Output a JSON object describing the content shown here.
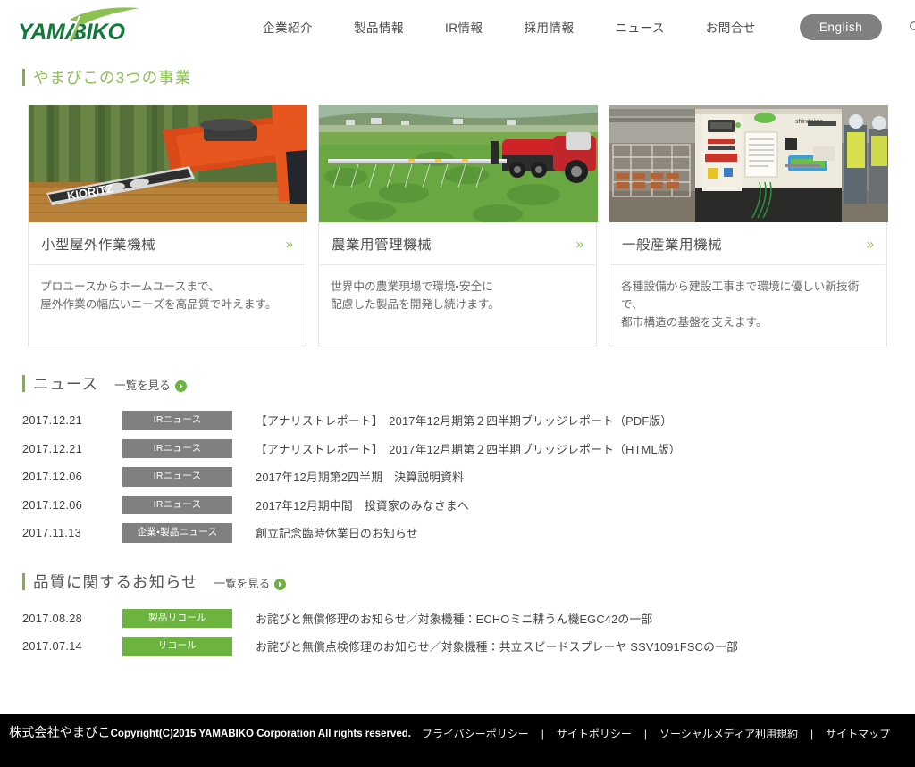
{
  "header": {
    "logo_text": "YAMABIKO",
    "logo_icon": "yamabiko-swoosh-logo",
    "nav": [
      {
        "label": "企業紹介"
      },
      {
        "label": "製品情報"
      },
      {
        "label": "IR情報"
      },
      {
        "label": "採用情報"
      },
      {
        "label": "ニュース"
      },
      {
        "label": "お問合せ"
      }
    ],
    "english_button": "English",
    "search_icon": "search-icon"
  },
  "business": {
    "heading": "やまびこの3つの事業",
    "cards": [
      {
        "title": "小型屋外作業機械",
        "desc": "プロユースからホームユースまで、\n屋外作業の幅広いニーズを高品質で叶えます。",
        "image_alt": "chainsaw-in-forest",
        "chevron": "»"
      },
      {
        "title": "農業用管理機械",
        "desc": "世界中の農業現場で環境・安全に\n配慮した製品を開発し続けます。",
        "image_alt": "agricultural-sprayer-in-field",
        "chevron": "»"
      },
      {
        "title": "一般産業用機械",
        "desc": "各種設備から建設工事まで環境に優しい新技術で、\n都市構造の基盤を支えます。",
        "image_alt": "industrial-generator-at-construction-site",
        "chevron": "»"
      }
    ]
  },
  "news": {
    "heading": "ニュース",
    "more_label": "一覧を見る",
    "items": [
      {
        "date": "2017.12.21",
        "badge": "IRニュース",
        "badge_type": "ir",
        "title": "【アナリストレポート】　2017年12月期第２四半期ブリッジレポート（PDF版）"
      },
      {
        "date": "2017.12.21",
        "badge": "IRニュース",
        "badge_type": "ir",
        "title": "【アナリストレポート】　2017年12月期第２四半期ブリッジレポート（HTML版）"
      },
      {
        "date": "2017.12.06",
        "badge": "IRニュース",
        "badge_type": "ir",
        "title": "2017年12月期第2四半期　決算説明資料"
      },
      {
        "date": "2017.12.06",
        "badge": "IRニュース",
        "badge_type": "ir",
        "title": "2017年12月期中間　投資家のみなさまへ"
      },
      {
        "date": "2017.11.13",
        "badge": "企業・製品ニュース",
        "badge_type": "corp",
        "title": "創立記念臨時休業日のお知らせ"
      }
    ]
  },
  "quality": {
    "heading": "品質に関するお知らせ",
    "more_label": "一覧を見る",
    "items": [
      {
        "date": "2017.08.28",
        "badge": "製品リコール",
        "badge_type": "recall",
        "title": "お詫びと無償修理のお知らせ／対象機種：ECHOミニ耕うん機EGC42の一部"
      },
      {
        "date": "2017.07.14",
        "badge": "リコール",
        "badge_type": "recall",
        "title": "お詫びと無償点検修理のお知らせ／対象機種：共立スピードスプレーヤ SSV1091FSCの一部"
      }
    ]
  },
  "footer": {
    "company": "株式会社やまびこ",
    "copyright": "Copyright(C)2015 YAMABIKO Corporation All rights reserved.",
    "links": [
      {
        "label": "プライバシーポリシー"
      },
      {
        "label": "サイトポリシー"
      },
      {
        "label": "ソーシャルメディア利用規約"
      },
      {
        "label": "サイトマップ"
      }
    ],
    "separator": "|"
  },
  "colors": {
    "brand_green_dark": "#1a7a3c",
    "brand_green_light": "#8cc152",
    "accent_green": "#6cb33f",
    "badge_gray": "#808080",
    "footer_bg": "#000000"
  }
}
